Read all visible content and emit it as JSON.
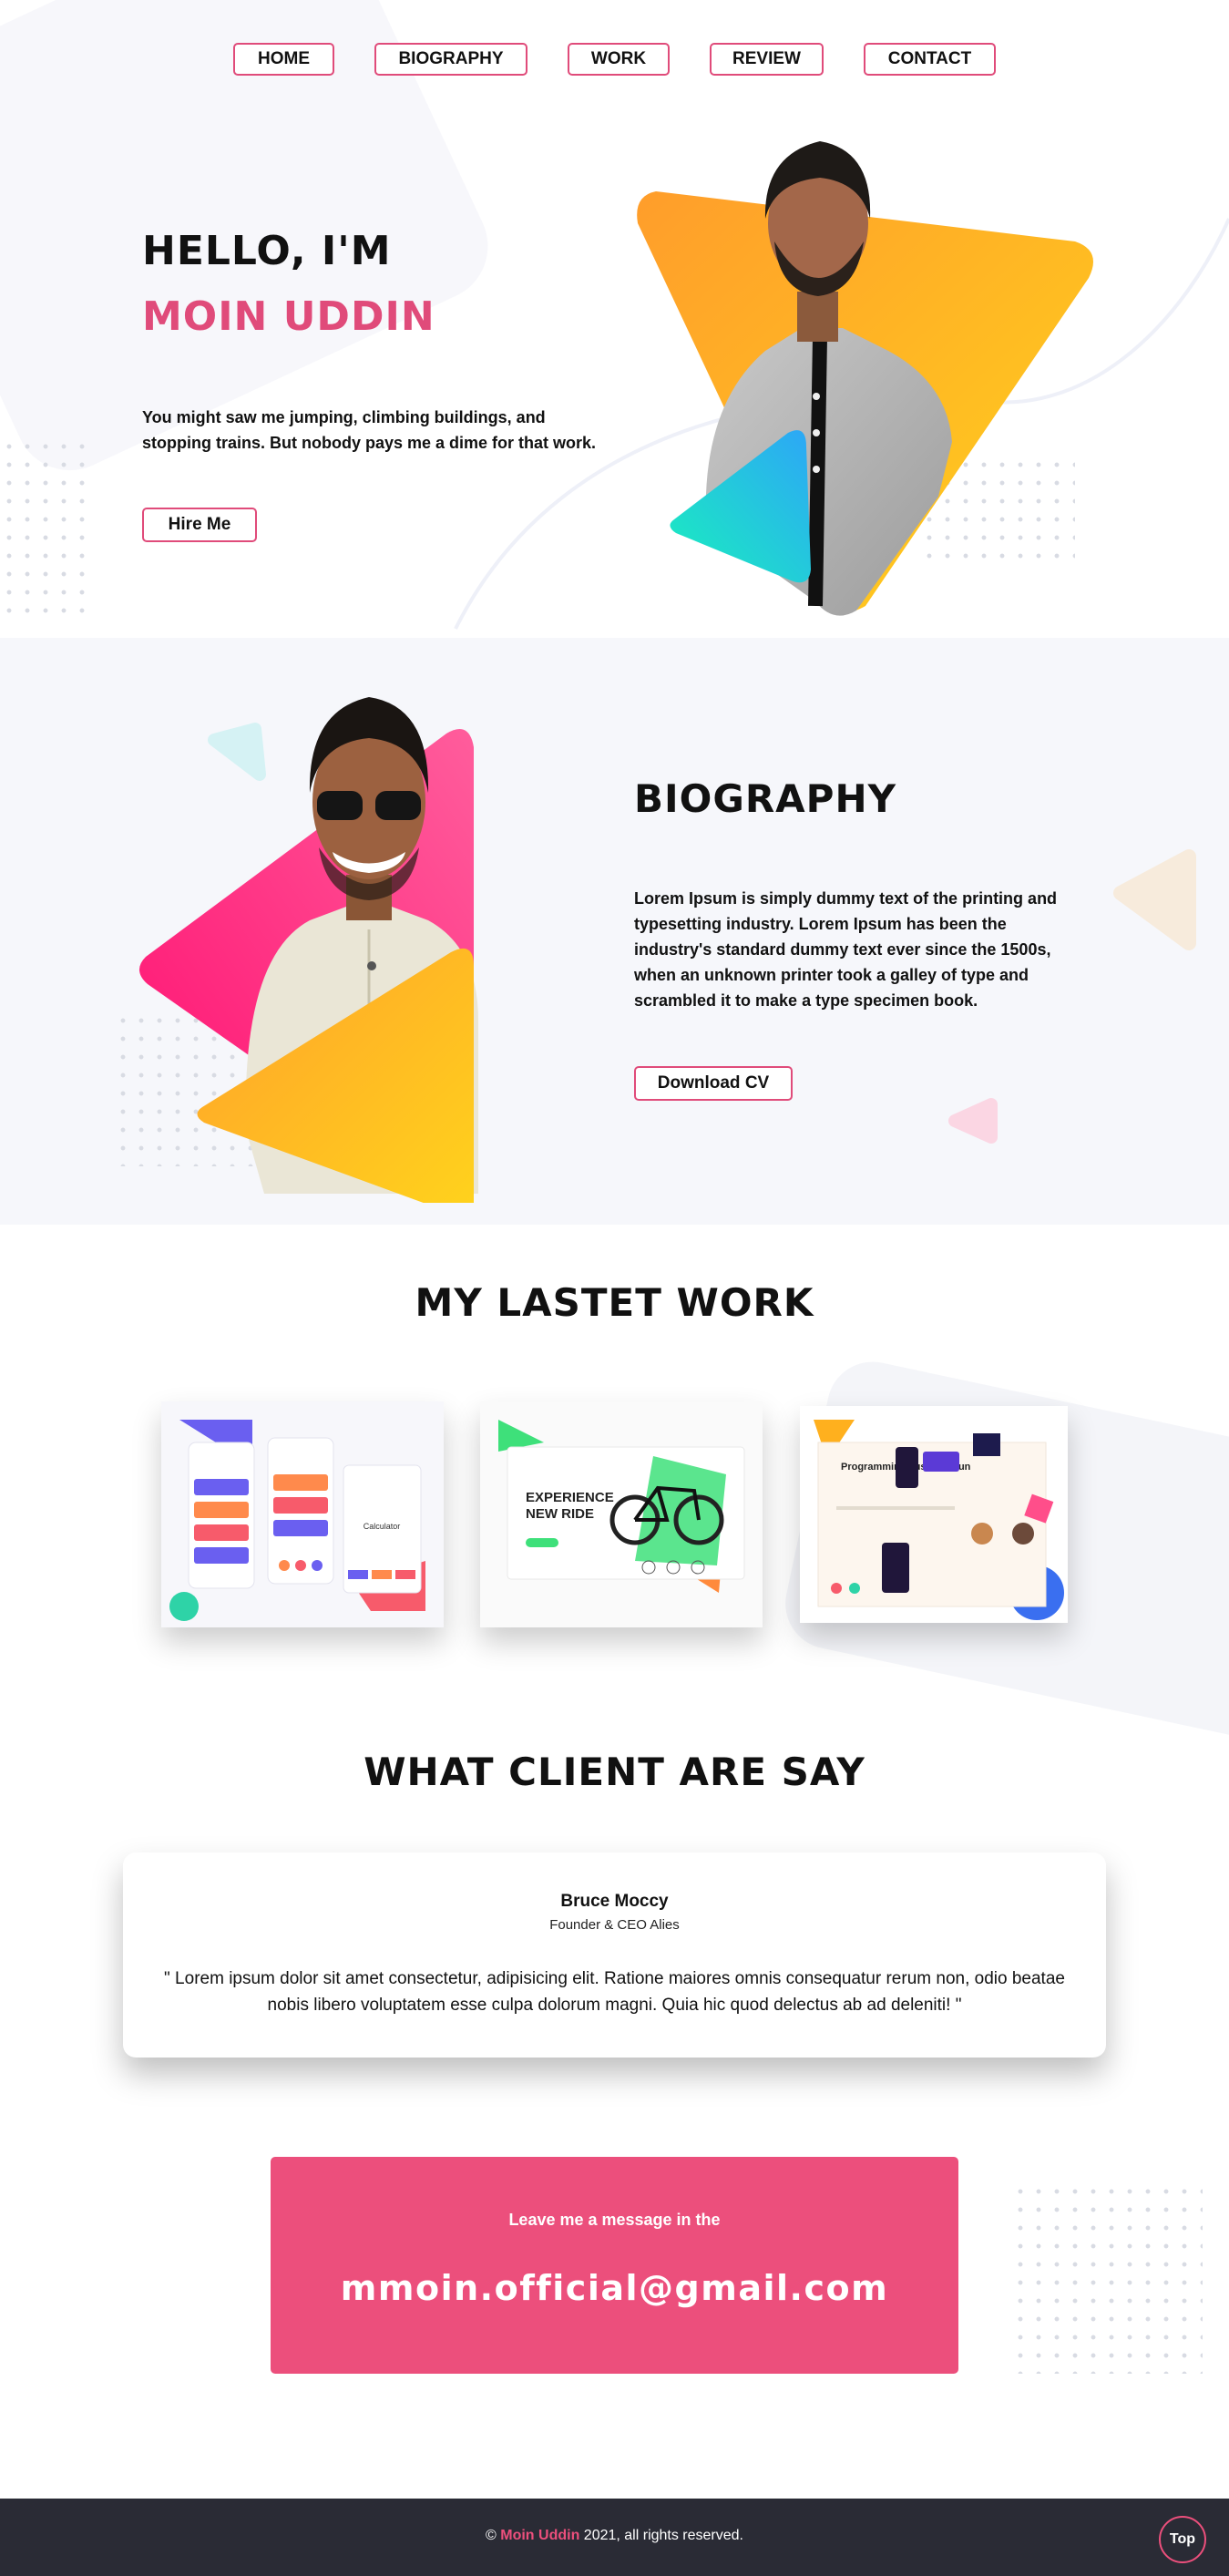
{
  "nav": {
    "items": [
      "HOME",
      "BIOGRAPHY",
      "WORK",
      "REVIEW",
      "CONTACT"
    ]
  },
  "hero": {
    "greeting": "HELLO, I'M",
    "name": "MOIN UDDIN",
    "description": "You might saw me jumping, climbing buildings, and stopping trains. But nobody pays me a dime for that work.",
    "cta": "Hire Me"
  },
  "biography": {
    "title": "BIOGRAPHY",
    "text": "Lorem Ipsum is simply dummy text of the printing and typesetting industry. Lorem Ipsum has been the industry's standard dummy text ever since the 1500s, when an unknown printer took a galley of type and scrambled it to make a type specimen book.",
    "cta": "Download CV"
  },
  "work": {
    "title": "MY LASTET WORK",
    "items": [
      {
        "name": "app-screens",
        "caption": "Calculator"
      },
      {
        "name": "bike-landing",
        "headline_1": "EXPERIENCE",
        "headline_2": "NEW RIDE"
      },
      {
        "name": "programming-site",
        "headline": "Programming Just Got Fun"
      }
    ]
  },
  "reviews": {
    "title": "WHAT CLIENT ARE SAY",
    "name": "Bruce Moccy",
    "role": "Founder & CEO Alies",
    "quote": "\" Lorem ipsum dolor sit amet consectetur, adipisicing elit. Ratione maiores omnis consequatur rerum non, odio beatae nobis libero voluptatem esse culpa dolorum magni. Quia hic quod delectus ab ad deleniti! \""
  },
  "contact": {
    "lead": "Leave me a message in the",
    "email": "mmoin.official@gmail.com"
  },
  "footer": {
    "copyright_symbol": "©",
    "brand": "Moin Uddin",
    "rest": "2021, all rights reserved.",
    "top_button": "Top"
  },
  "colors": {
    "accent_pink": "#e04b7a",
    "contact_bg": "#ec4f7c",
    "footer_bg": "#2a2b35",
    "section_bg": "#f6f7fb",
    "orange": "#ffb01e",
    "teal": "#14e0c0"
  }
}
